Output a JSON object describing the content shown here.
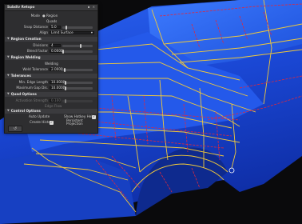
{
  "panel": {
    "title": "Subdiv Retopo",
    "mode_label": "Mode",
    "mode_value": "Region",
    "mode_value2": "Quads",
    "snap_distance_label": "Snap Distance",
    "snap_distance_value": "5.0",
    "align_label": "Align",
    "align_value": "Limit Surface",
    "region_creation_header": "Region Creation",
    "divisions_label": "Divisions",
    "divisions_value": "4",
    "blend_factor_label": "Blend Factor",
    "blend_factor_value": "0.0000",
    "region_welding_header": "Region Welding",
    "welding_label": "Welding",
    "weld_tolerance_label": "Weld Tolerance",
    "weld_tolerance_value": "2.0000",
    "tolerances_header": "Tolerances",
    "min_edge_label": "Min. Edge Length",
    "min_edge_value": "10.0000",
    "max_gap_label": "Maximum Gap Dis.",
    "max_gap_value": "10.0000",
    "quad_options_header": "Quad Options",
    "activation_strength_label": "Activation Strength",
    "activation_strength_value": "0.100",
    "edge_flow_label": "Edge Flow",
    "control_options_header": "Control Options",
    "auto_update_label": "Auto Update",
    "show_hotkey_label": "Show Hotkey Help",
    "create_history_label": "Create History",
    "persistent_projection_label": "Persistent Projection",
    "reset_icon": "undo-icon"
  },
  "colors": {
    "car_body": "#1a4bd8",
    "wire_yellow": "#f0c83a",
    "wire_red": "#e0283c",
    "background": "#0a0a0c"
  }
}
